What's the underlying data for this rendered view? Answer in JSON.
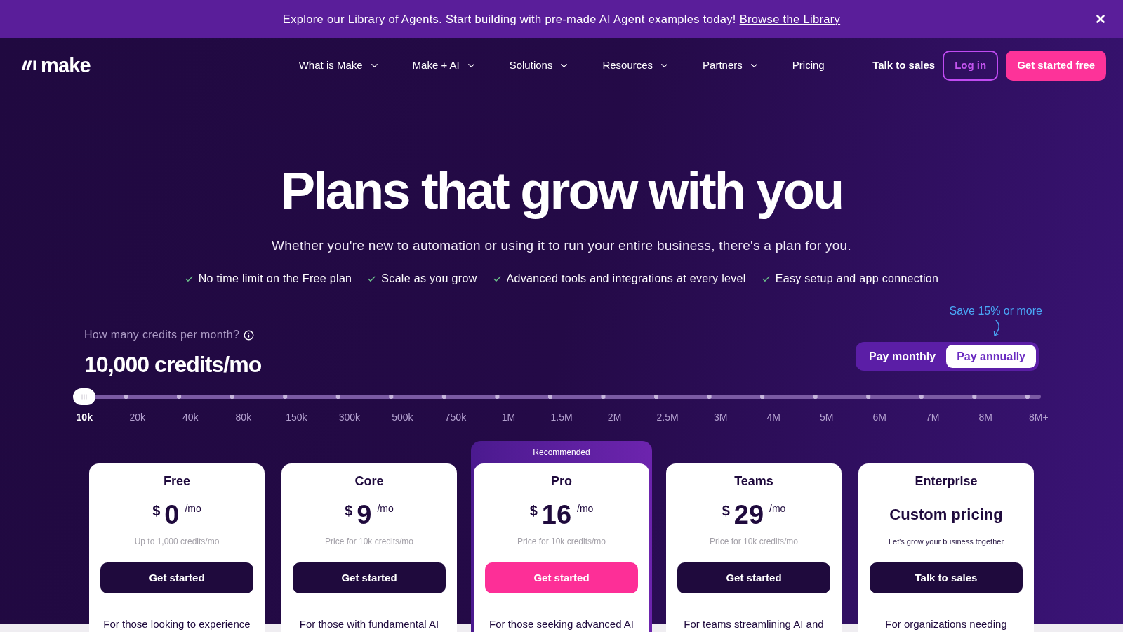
{
  "banner": {
    "text": "Explore our Library of Agents. Start building with pre-made AI Agent examples today!",
    "link": "Browse the Library"
  },
  "nav": {
    "logo": "make",
    "items": [
      {
        "label": "What is Make",
        "dropdown": true
      },
      {
        "label": "Make + AI",
        "dropdown": true
      },
      {
        "label": "Solutions",
        "dropdown": true
      },
      {
        "label": "Resources",
        "dropdown": true
      },
      {
        "label": "Partners",
        "dropdown": true
      },
      {
        "label": "Pricing",
        "dropdown": false
      }
    ],
    "talk_to_sales": "Talk to sales",
    "log_in": "Log in",
    "get_started": "Get started free"
  },
  "hero": {
    "title": "Plans that grow with you",
    "subtitle": "Whether you're new to automation or using it to run your entire business, there's a plan for you.",
    "highlights": [
      "No time limit on the Free plan",
      "Scale as you grow",
      "Advanced tools and integrations at every level",
      "Easy setup and app connection"
    ]
  },
  "credits": {
    "question": "How many credits per month?",
    "value": "10,000 credits/mo",
    "slider": {
      "level": 0,
      "ticks": [
        {
          "label": "10k",
          "selected": true
        },
        {
          "label": "20k",
          "selected": false
        },
        {
          "label": "40k",
          "selected": false
        },
        {
          "label": "80k",
          "selected": false
        },
        {
          "label": "150k",
          "selected": false
        },
        {
          "label": "300k",
          "selected": false
        },
        {
          "label": "500k",
          "selected": false
        },
        {
          "label": "750k",
          "selected": false
        },
        {
          "label": "1M",
          "selected": false
        },
        {
          "label": "1.5M",
          "selected": false
        },
        {
          "label": "2M",
          "selected": false
        },
        {
          "label": "2.5M",
          "selected": false
        },
        {
          "label": "3M",
          "selected": false
        },
        {
          "label": "4M",
          "selected": false
        },
        {
          "label": "5M",
          "selected": false
        },
        {
          "label": "6M",
          "selected": false
        },
        {
          "label": "7M",
          "selected": false
        },
        {
          "label": "8M",
          "selected": false
        },
        {
          "label": "8M+",
          "selected": false
        }
      ]
    }
  },
  "billing": {
    "note": "Save 15% or more",
    "options": [
      {
        "label": "Pay monthly",
        "selected": false
      },
      {
        "label": "Pay annually",
        "selected": true
      }
    ]
  },
  "plans": [
    {
      "name": "Free",
      "kind": "price",
      "currency": "$",
      "amount": "0",
      "period": "/mo",
      "note": "Up to 1,000 credits/mo",
      "button": "Get started",
      "recommended": false,
      "description": "For those looking to experience"
    },
    {
      "name": "Core",
      "kind": "price",
      "currency": "$",
      "amount": "9",
      "period": "/mo",
      "note": "Price for 10k credits/mo",
      "button": "Get started",
      "recommended": false,
      "description": "For those with fundamental AI"
    },
    {
      "name": "Pro",
      "kind": "price",
      "currency": "$",
      "amount": "16",
      "period": "/mo",
      "note": "Price for 10k credits/mo",
      "button": "Get started",
      "recommended": true,
      "badge": "Recommended",
      "description": "For those seeking advanced AI"
    },
    {
      "name": "Teams",
      "kind": "price",
      "currency": "$",
      "amount": "29",
      "period": "/mo",
      "note": "Price for 10k credits/mo",
      "button": "Get started",
      "recommended": false,
      "description": "For teams streamlining AI and"
    },
    {
      "name": "Enterprise",
      "kind": "custom",
      "price_text": "Custom pricing",
      "note": "Let's grow your business together",
      "button": "Talk to sales",
      "recommended": false,
      "description": "For organizations needing"
    }
  ]
}
